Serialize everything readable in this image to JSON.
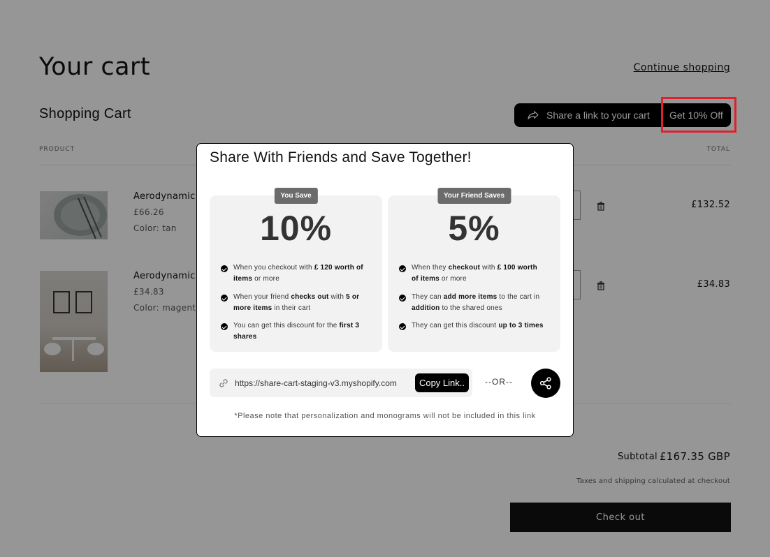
{
  "page": {
    "title": "Your cart",
    "continue_shopping": "Continue shopping",
    "section_title": "Shopping Cart"
  },
  "share_bar": {
    "share_link_label": "Share a link to your cart",
    "discount_label": "Get 10% Off",
    "highlight_color": "#e0202d"
  },
  "table": {
    "headers": {
      "product": "PRODUCT",
      "total": "TOTAL"
    },
    "items": [
      {
        "name": "Aerodynamic M",
        "price": "£66.26",
        "color": "Color: tan",
        "total": "£132.52"
      },
      {
        "name": "Aerodynamic A",
        "price": "£34.83",
        "color": "Color: magenta",
        "total": "£34.83"
      }
    ]
  },
  "summary": {
    "subtotal_label": "Subtotal",
    "subtotal_value": "£167.35 GBP",
    "tax_note": "Taxes and shipping calculated at checkout",
    "checkout_label": "Check out"
  },
  "modal": {
    "title": "Share With Friends and Save Together!",
    "left_card": {
      "tag": "You Save",
      "big": "10%",
      "rows": [
        {
          "a": "When you checkout with ",
          "b": "£ 120 worth of items",
          "c": " or more"
        },
        {
          "a": "When your friend ",
          "b": "checks out",
          "c": " with ",
          "d": "5 or more items",
          "e": " in their cart"
        },
        {
          "a": "You can get this discount for the ",
          "b": "first 3 shares",
          "c": ""
        }
      ]
    },
    "right_card": {
      "tag": "Your Friend Saves",
      "big": "5%",
      "rows": [
        {
          "a": "When they ",
          "b": "checkout",
          "c": " with ",
          "d": "£ 100 worth of items",
          "e": " or more"
        },
        {
          "a": "They can ",
          "b": "add more items",
          "c": " to the cart in ",
          "d": "addition",
          "e": " to the shared ones"
        },
        {
          "a": "They can get this discount ",
          "b": "up to 3 times",
          "c": ""
        }
      ]
    },
    "link_url": "https://share-cart-staging-v3.myshopify.com",
    "copy_label": "Copy Link..",
    "or_text": "--OR--",
    "note": "*Please note that personalization and monograms will not be included in this link"
  }
}
